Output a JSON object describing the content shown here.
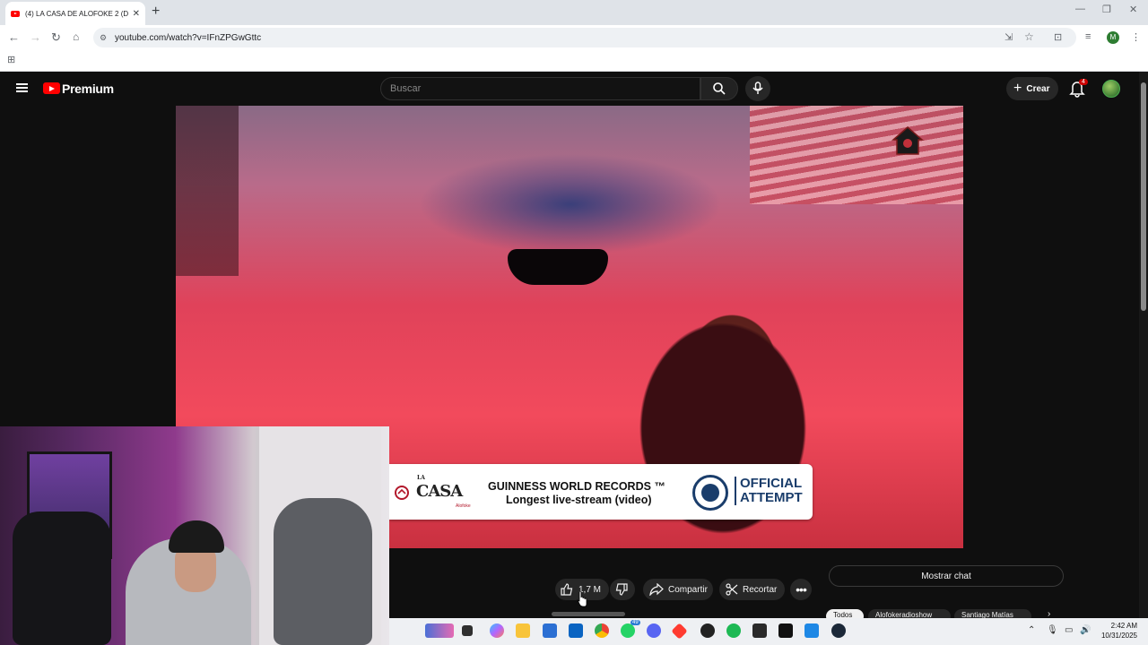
{
  "browser": {
    "tab_title": "(4) LA CASA DE ALOFOKE 2 (D",
    "tab_close": "✕",
    "new_tab": "+",
    "url": "youtube.com/watch?v=IFnZPGwGttc",
    "profile_initial": "M"
  },
  "youtube": {
    "brand": "Premium",
    "search_placeholder": "Buscar",
    "create_label": "Crear",
    "notifications_count": "4"
  },
  "video_overlay": {
    "brand_text": "CASA",
    "brand_small": "LA",
    "brand_sub": "Alofoke",
    "gwr_line1": "GUINNESS WORLD RECORDS ™",
    "gwr_line2": "Longest live-stream (video)",
    "official_line1": "OFFICIAL",
    "official_line2": "ATTEMPT"
  },
  "actions": {
    "like_count": "1,7 M",
    "share_label": "Compartir",
    "clip_label": "Recortar",
    "more_label": "•••",
    "show_chat": "Mostrar chat"
  },
  "chips": [
    "Todos",
    "Alofokeradioshow",
    "Santiago Matías"
  ],
  "taskbar": {
    "time": "2:42 AM",
    "date": "10/31/2025",
    "whatsapp_badge": "49"
  },
  "colors": {
    "youtube_red": "#ff0000",
    "dark_bg": "#0f0f0f",
    "pill_bg": "#272727",
    "gwr_blue": "#1a3d6b"
  }
}
